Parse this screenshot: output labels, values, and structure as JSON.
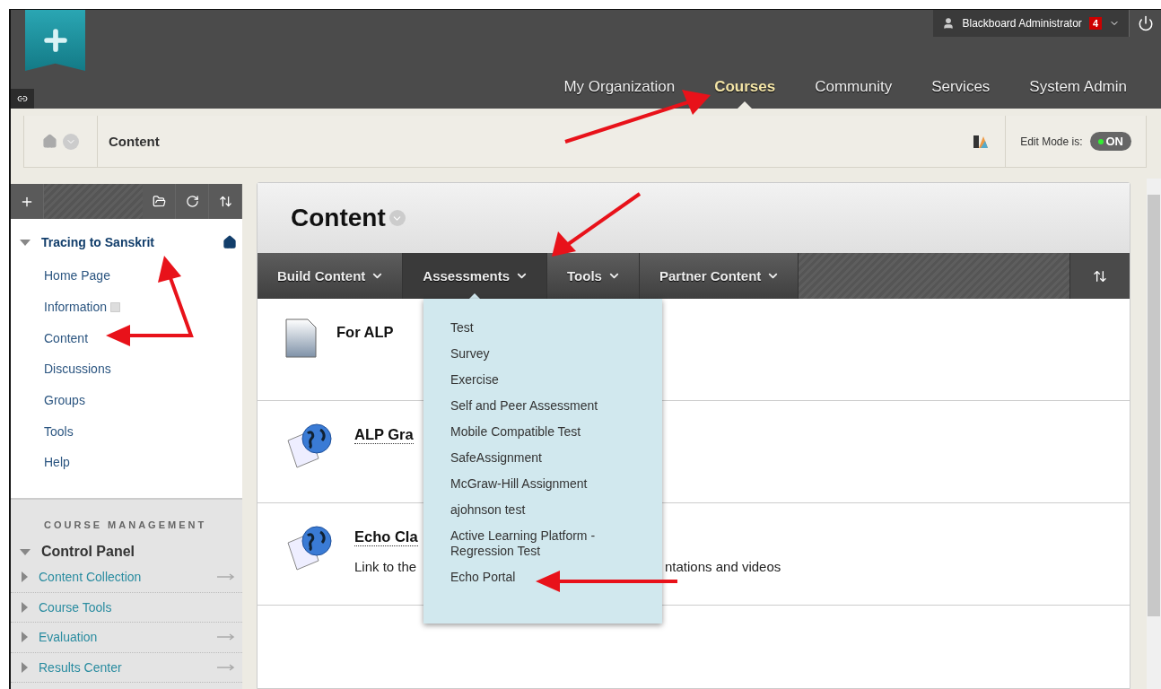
{
  "header": {
    "user": {
      "name": "Blackboard Administrator",
      "notifications": "4"
    },
    "nav": [
      {
        "label": "My Organization",
        "selected": false
      },
      {
        "label": "Courses",
        "selected": true
      },
      {
        "label": "Community",
        "selected": false
      },
      {
        "label": "Services",
        "selected": false
      },
      {
        "label": "System Admin",
        "selected": false
      }
    ]
  },
  "breadcrumb": {
    "current": "Content",
    "edit_mode": {
      "label": "Edit Mode is:",
      "state": "ON",
      "on": true
    }
  },
  "sidebar": {
    "course": {
      "title": "Tracing to Sanskrit",
      "expanded": true,
      "items": [
        {
          "label": "Home Page"
        },
        {
          "label": "Information",
          "kind": "hidden"
        },
        {
          "label": "Content"
        },
        {
          "label": "Discussions"
        },
        {
          "label": "Groups"
        },
        {
          "label": "Tools"
        },
        {
          "label": "Help"
        }
      ]
    },
    "management": {
      "heading": "COURSE MANAGEMENT",
      "panel": {
        "title": "Control Panel",
        "expanded": true
      },
      "items": [
        {
          "label": "Content Collection",
          "expanded": false,
          "kind": "link"
        },
        {
          "label": "Course Tools",
          "expanded": false,
          "kind": "plain"
        },
        {
          "label": "Evaluation",
          "expanded": false,
          "kind": "link"
        },
        {
          "label": "Results Center",
          "expanded": false,
          "kind": "link"
        }
      ]
    }
  },
  "main": {
    "title": "Content",
    "action_bar": [
      {
        "label": "Build Content",
        "selected": false
      },
      {
        "label": "Assessments",
        "selected": true
      },
      {
        "label": "Tools",
        "selected": false
      },
      {
        "label": "Partner Content",
        "selected": false
      }
    ],
    "dropdown": [
      "Test",
      "Survey",
      "Exercise",
      "Self and Peer Assessment",
      "Mobile Compatible Test",
      "SafeAssignment",
      "McGraw-Hill Assignment",
      "ajohnson test",
      "Active Learning Platform - Regression Test",
      "Echo Portal"
    ],
    "items": [
      {
        "kind": "document",
        "title": "For ALP",
        "link": false
      },
      {
        "kind": "web-link",
        "title": "ALP Gra",
        "link": true
      },
      {
        "kind": "web-link",
        "title": "Echo Cla",
        "link": true,
        "description_start": "Link to the",
        "description_end": "ntations and videos"
      }
    ]
  }
}
